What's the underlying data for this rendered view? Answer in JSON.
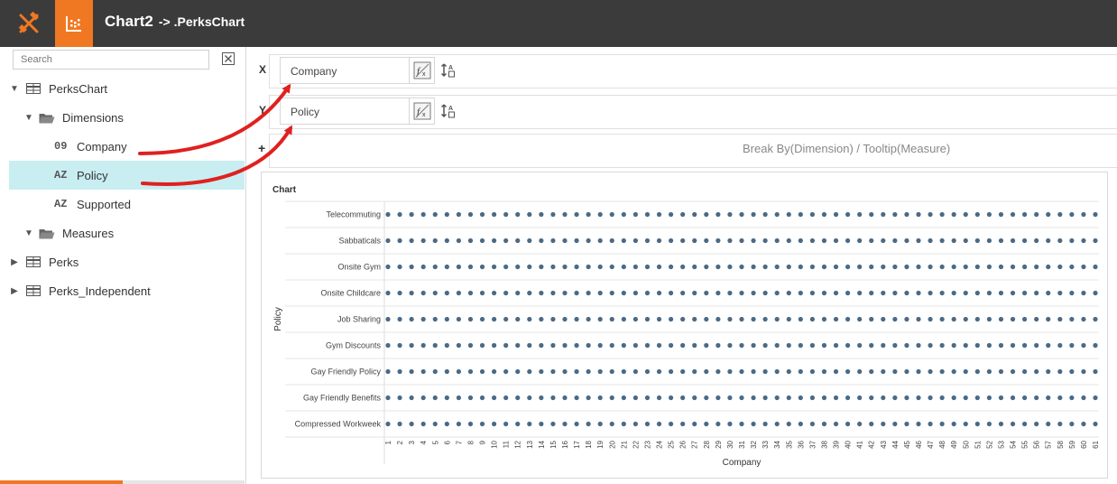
{
  "app": {
    "title": "Chart2",
    "subtitle": "-> .PerksChart",
    "colors": {
      "topbar": "#3b3b3b",
      "accent": "#f07822",
      "selection": "#c8eef2",
      "marker": "#4a6a86",
      "annotation_arrow": "#e02020"
    }
  },
  "toolbar": {
    "tools_icon": "tools-icon",
    "chart_icon": "chart-icon"
  },
  "sidebar": {
    "search_placeholder": "Search",
    "tree": [
      {
        "label": "PerksChart",
        "kind": "table",
        "expanded": true
      },
      {
        "label": "Dimensions",
        "kind": "folder",
        "expanded": true
      },
      {
        "label": "Company",
        "kind": "field",
        "type_badge": "09"
      },
      {
        "label": "Policy",
        "kind": "field",
        "type_badge": "AZ",
        "selected": true
      },
      {
        "label": "Supported",
        "kind": "field",
        "type_badge": "AZ"
      },
      {
        "label": "Measures",
        "kind": "folder",
        "expanded": true
      },
      {
        "label": "Perks",
        "kind": "table",
        "expanded": false
      },
      {
        "label": "Perks_Independent",
        "kind": "table",
        "expanded": false
      }
    ]
  },
  "shelves": {
    "x_label": "X",
    "x_field": "Company",
    "y_label": "Y",
    "y_field": "Policy",
    "plus_label": "+",
    "breakby_placeholder": "Break By(Dimension) / Tooltip(Measure)"
  },
  "chart_data": {
    "type": "scatter",
    "title": "Chart",
    "xlabel": "Company",
    "ylabel": "Policy",
    "x_categories": [
      "1",
      "2",
      "3",
      "4",
      "5",
      "6",
      "7",
      "8",
      "9",
      "10",
      "11",
      "12",
      "13",
      "14",
      "15",
      "16",
      "17",
      "18",
      "19",
      "20",
      "21",
      "22",
      "23",
      "24",
      "25",
      "26",
      "27",
      "28",
      "29",
      "30",
      "31",
      "32",
      "33",
      "34",
      "35",
      "36",
      "37",
      "38",
      "39",
      "40",
      "41",
      "42",
      "43",
      "44",
      "45",
      "46",
      "47",
      "48",
      "49",
      "50",
      "51",
      "52",
      "53",
      "54",
      "55",
      "56",
      "57",
      "58",
      "59",
      "60",
      "61"
    ],
    "y_categories": [
      "Telecommuting",
      "Sabbaticals",
      "Onsite Gym",
      "Onsite Childcare",
      "Job Sharing",
      "Gym Discounts",
      "Gay Friendly Policy",
      "Gay Friendly Benefits",
      "Compressed Workweek"
    ],
    "points": "every x_category paired with every y_category",
    "grid": true,
    "legend": "none"
  }
}
